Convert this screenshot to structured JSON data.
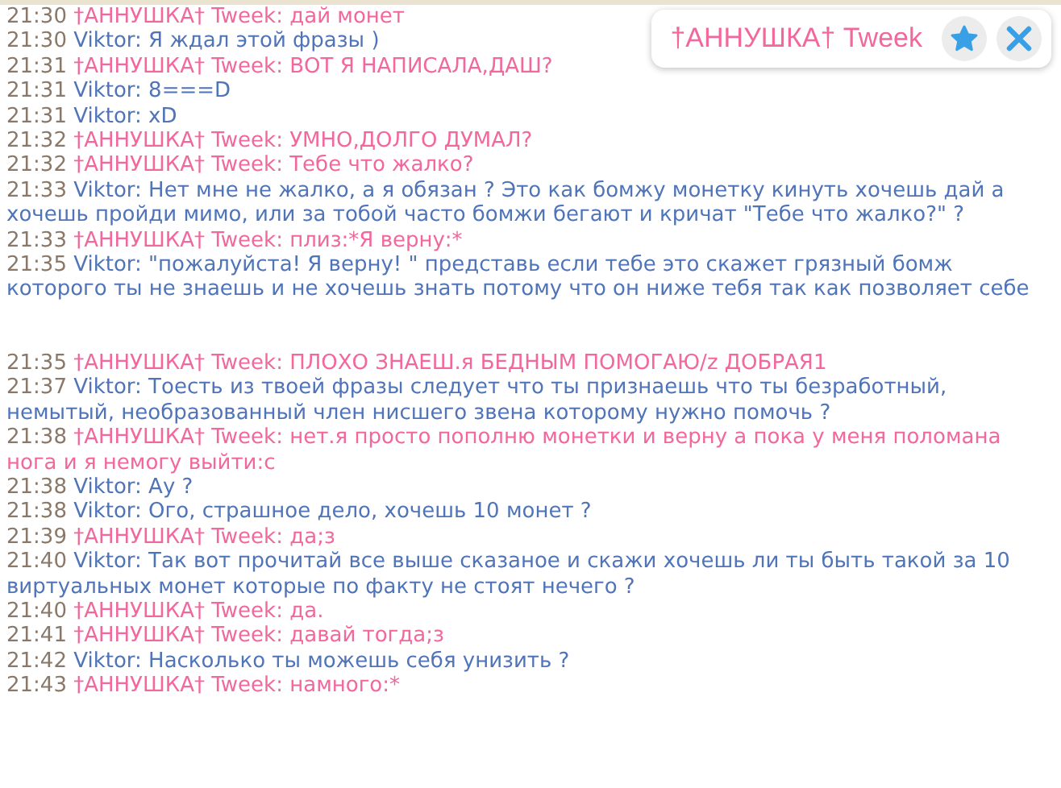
{
  "header": {
    "title": "†АННУШКА† Tweek"
  },
  "messages": [
    {
      "time": "21:30",
      "sender": "†АННУШКА† Tweek:",
      "text": "дай монет",
      "kind": "her"
    },
    {
      "time": "21:30",
      "sender": "Viktor:",
      "text": "Я ждал этой фразы )",
      "kind": "him"
    },
    {
      "time": "21:31",
      "sender": "†АННУШКА† Tweek:",
      "text": "ВОТ Я НАПИСАЛА,ДАШ?",
      "kind": "her"
    },
    {
      "time": "21:31",
      "sender": "Viktor:",
      "text": "8===D",
      "kind": "him"
    },
    {
      "time": "21:31",
      "sender": "Viktor:",
      "text": "xD",
      "kind": "him"
    },
    {
      "time": "21:32",
      "sender": "†АННУШКА† Tweek:",
      "text": "УМНО,ДОЛГО ДУМАЛ?",
      "kind": "her"
    },
    {
      "time": "21:32",
      "sender": "†АННУШКА† Tweek:",
      "text": "Тебе что жалко?",
      "kind": "her"
    },
    {
      "time": "21:33",
      "sender": "Viktor:",
      "text": "Нет мне не жалко, а я обязан ? Это как бомжу монетку кинуть хочешь дай а хочешь пройди мимо, или за тобой часто бомжи бегают и кричат \"Тебе что жалко?\" ?",
      "kind": "him"
    },
    {
      "time": "21:33",
      "sender": "†АННУШКА† Tweek:",
      "text": "плиз:*Я верну:*",
      "kind": "her"
    },
    {
      "time": "21:35",
      "sender": "Viktor:",
      "text": "\"пожалуйста! Я верну! \" представь если тебе это скажет грязный бомж которого ты не знаешь и не хочешь знать потому что он ниже тебя так как позволяет себе",
      "kind": "him",
      "trailing_gap": true
    },
    {
      "time": "21:35",
      "sender": "†АННУШКА† Tweek:",
      "text": "ПЛОХО ЗНАЕШ.я БЕДНЫМ ПОМОГАЮ/z ДОБРАЯ1",
      "kind": "her"
    },
    {
      "time": "21:37",
      "sender": "Viktor:",
      "text": "Тоесть из твоей фразы следует что ты признаешь что ты безработный, немытый, необразованный член нисшего звена которому нужно помочь ?",
      "kind": "him"
    },
    {
      "time": "21:38",
      "sender": "†АННУШКА† Tweek:",
      "text": "нет.я просто пополню монетки и верну а пока у меня поломана нога и  я немогу выйти:с",
      "kind": "her"
    },
    {
      "time": "21:38",
      "sender": "Viktor:",
      "text": "Ау ?",
      "kind": "him"
    },
    {
      "time": "21:38",
      "sender": "Viktor:",
      "text": "Ого, страшное дело, хочешь 10 монет ?",
      "kind": "him"
    },
    {
      "time": "21:39",
      "sender": "†АННУШКА† Tweek:",
      "text": "да;з",
      "kind": "her"
    },
    {
      "time": "21:40",
      "sender": "Viktor:",
      "text": "Так вот прочитай все выше сказаное и скажи хочешь ли ты быть такой за 10 виртуальных монет которые по факту не стоят нечего ?",
      "kind": "him"
    },
    {
      "time": "21:40",
      "sender": "†АННУШКА† Tweek:",
      "text": "да.",
      "kind": "her"
    },
    {
      "time": "21:41",
      "sender": "†АННУШКА† Tweek:",
      "text": "давай тогда;з",
      "kind": "her"
    },
    {
      "time": "21:42",
      "sender": "Viktor:",
      "text": "Насколько ты можешь себя унизить ?",
      "kind": "him"
    },
    {
      "time": "21:43",
      "sender": "†АННУШКА† Tweek:",
      "text": "намного:*",
      "kind": "her"
    }
  ]
}
